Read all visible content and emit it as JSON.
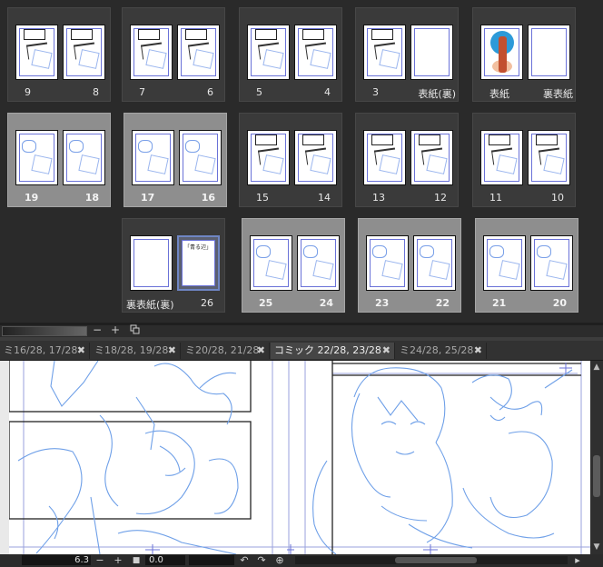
{
  "pages_panel": {
    "spreads": [
      {
        "left_label": "9",
        "right_label": "8",
        "selected": false,
        "right_kind": "manga"
      },
      {
        "left_label": "7",
        "right_label": "6",
        "selected": false,
        "right_kind": "manga"
      },
      {
        "left_label": "5",
        "right_label": "4",
        "selected": false,
        "right_kind": "manga"
      },
      {
        "left_label": "3",
        "right_label": "表紙(裏)",
        "selected": false,
        "right_kind": "blank"
      },
      {
        "left_label": "表紙",
        "right_label": "裏表紙",
        "selected": false,
        "right_kind": "blank",
        "left_kind": "cover"
      },
      {
        "left_label": "19",
        "right_label": "18",
        "selected": true,
        "right_kind": "sketch"
      },
      {
        "left_label": "17",
        "right_label": "16",
        "selected": true,
        "right_kind": "sketch"
      },
      {
        "left_label": "15",
        "right_label": "14",
        "selected": false,
        "right_kind": "manga"
      },
      {
        "left_label": "13",
        "right_label": "12",
        "selected": false,
        "right_kind": "manga"
      },
      {
        "left_label": "11",
        "right_label": "10",
        "selected": false,
        "right_kind": "manga"
      },
      {
        "left_label": "裏表紙(裏)",
        "right_label": "26",
        "selected": false,
        "right_kind": "colophon",
        "left_kind": "blank"
      },
      {
        "left_label": "25",
        "right_label": "24",
        "selected": true,
        "right_kind": "sketch"
      },
      {
        "left_label": "23",
        "right_label": "22",
        "selected": true,
        "right_kind": "sketch"
      },
      {
        "left_label": "21",
        "right_label": "20",
        "selected": true,
        "right_kind": "sketch"
      }
    ],
    "colophon_title": "「青る辺」",
    "zoom_minus": "−",
    "zoom_plus": "+"
  },
  "tabs": [
    {
      "label": "ミ16/28, 17/28",
      "active": false
    },
    {
      "label": "ミ18/28, 19/28",
      "active": false
    },
    {
      "label": "ミ20/28, 21/28",
      "active": false
    },
    {
      "label": "コミック 22/28, 23/28",
      "active": true
    },
    {
      "label": "ミ24/28, 25/28",
      "active": false
    }
  ],
  "tab_close_glyph": "✖",
  "statusbar": {
    "zoom": "6.3",
    "angle": "0.0",
    "minus": "−",
    "plus": "+"
  },
  "colors": {
    "panel_bg": "#2a2a2a",
    "selected_spread": "#8e8e8e",
    "sketch_blue": "#6fa0e8",
    "frame_violet": "#6a72d8"
  }
}
